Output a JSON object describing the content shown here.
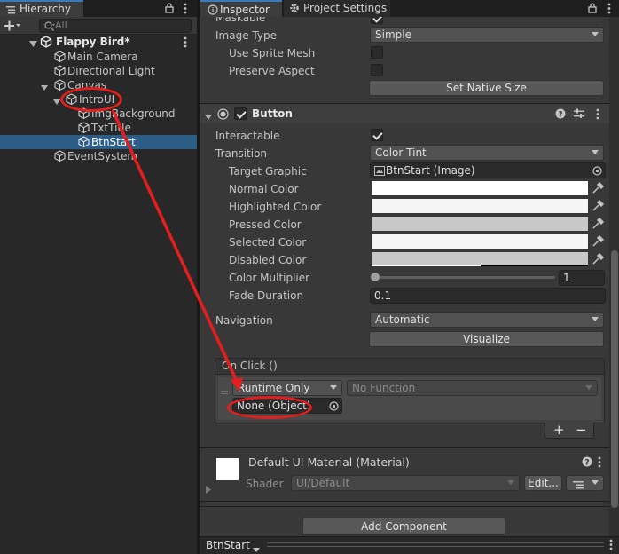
{
  "hierarchy": {
    "tab_label": "Hierarchy",
    "search_placeholder": "All",
    "scene_name": "Flappy Bird*",
    "items": [
      {
        "label": "Main Camera"
      },
      {
        "label": "Directional Light"
      },
      {
        "label": "Canvas"
      },
      {
        "label": "IntroUI"
      },
      {
        "label": "ImgBackground"
      },
      {
        "label": "TxtTitle"
      },
      {
        "label": "BtnStart"
      },
      {
        "label": "EventSystem"
      }
    ]
  },
  "inspector": {
    "tabs": [
      {
        "label": "Inspector"
      },
      {
        "label": "Project Settings"
      }
    ],
    "image": {
      "maskable_label": "Maskable",
      "image_type_label": "Image Type",
      "image_type_value": "Simple",
      "use_sprite_mesh_label": "Use Sprite Mesh",
      "preserve_aspect_label": "Preserve Aspect",
      "set_native_size": "Set Native Size"
    },
    "button": {
      "title": "Button",
      "interactable_label": "Interactable",
      "transition_label": "Transition",
      "transition_value": "Color Tint",
      "target_graphic_label": "Target Graphic",
      "target_graphic_value": "BtnStart (Image)",
      "normal_color_label": "Normal Color",
      "highlighted_color_label": "Highlighted Color",
      "pressed_color_label": "Pressed Color",
      "selected_color_label": "Selected Color",
      "disabled_color_label": "Disabled Color",
      "color_multiplier_label": "Color Multiplier",
      "color_multiplier_value": "1",
      "fade_duration_label": "Fade Duration",
      "fade_duration_value": "0.1",
      "navigation_label": "Navigation",
      "navigation_value": "Automatic",
      "visualize": "Visualize",
      "onclick_header": "On Click ()",
      "runtime_value": "Runtime Only",
      "function_value": "No Function",
      "object_value": "None (Object)",
      "add_symbol": "+",
      "remove_symbol": "−"
    },
    "material": {
      "name": "Default UI Material (Material)",
      "shader_label": "Shader",
      "shader_value": "UI/Default",
      "edit_label": "Edit..."
    },
    "add_component": "Add Component",
    "status_object": "BtnStart"
  },
  "colors": {
    "selection": "#2c5d87",
    "annotation": "#e31e1e",
    "accent": "#3a79bb"
  }
}
